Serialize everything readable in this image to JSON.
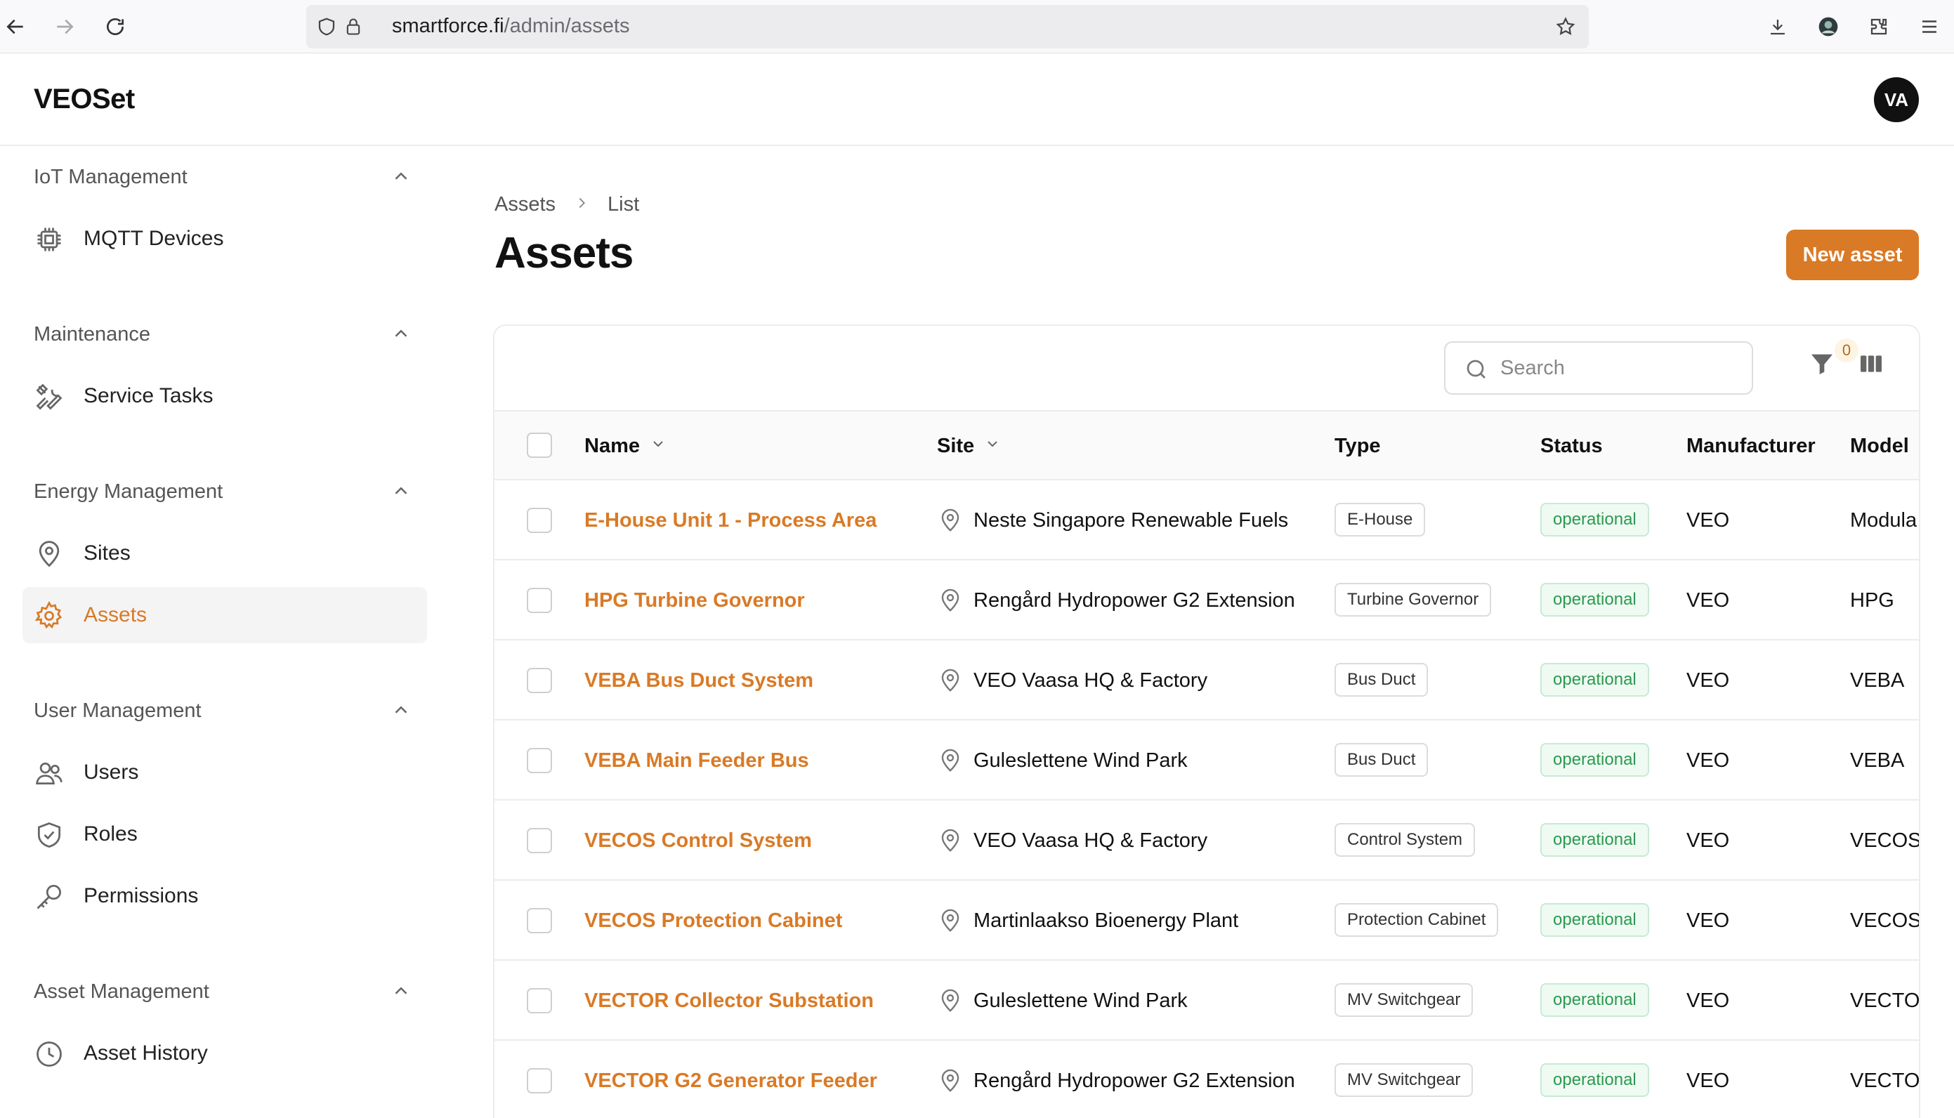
{
  "browser": {
    "url_host": "smartforce.fi",
    "url_path": "/admin/assets"
  },
  "app": {
    "brand": "VEOSet",
    "user_initials": "VA"
  },
  "sidebar": {
    "groups": [
      {
        "title": "IoT Management",
        "items": [
          {
            "label": "MQTT Devices",
            "icon": "chip-icon"
          }
        ]
      },
      {
        "title": "Maintenance",
        "items": [
          {
            "label": "Service Tasks",
            "icon": "tools-icon"
          }
        ]
      },
      {
        "title": "Energy Management",
        "items": [
          {
            "label": "Sites",
            "icon": "map-pin-icon"
          },
          {
            "label": "Assets",
            "icon": "cog-icon",
            "active": true
          }
        ]
      },
      {
        "title": "User Management",
        "items": [
          {
            "label": "Users",
            "icon": "users-icon"
          },
          {
            "label": "Roles",
            "icon": "shield-check-icon"
          },
          {
            "label": "Permissions",
            "icon": "key-icon"
          }
        ]
      },
      {
        "title": "Asset Management",
        "items": [
          {
            "label": "Asset History",
            "icon": "clock-icon"
          }
        ]
      }
    ]
  },
  "page": {
    "breadcrumb": [
      "Assets",
      "List"
    ],
    "title": "Assets",
    "new_button": "New asset"
  },
  "toolbar": {
    "search_placeholder": "Search",
    "filter_count": "0"
  },
  "table": {
    "columns": {
      "name": "Name",
      "site": "Site",
      "type": "Type",
      "status": "Status",
      "manufacturer": "Manufacturer",
      "model": "Model"
    },
    "rows": [
      {
        "name": "E-House Unit 1 - Process Area",
        "site": "Neste Singapore Renewable Fuels",
        "type": "E-House",
        "status": "operational",
        "manufacturer": "VEO",
        "model": "Modula"
      },
      {
        "name": "HPG Turbine Governor",
        "site": "Rengård Hydropower G2 Extension",
        "type": "Turbine Governor",
        "status": "operational",
        "manufacturer": "VEO",
        "model": "HPG"
      },
      {
        "name": "VEBA Bus Duct System",
        "site": "VEO Vaasa HQ & Factory",
        "type": "Bus Duct",
        "status": "operational",
        "manufacturer": "VEO",
        "model": "VEBA"
      },
      {
        "name": "VEBA Main Feeder Bus",
        "site": "Guleslettene Wind Park",
        "type": "Bus Duct",
        "status": "operational",
        "manufacturer": "VEO",
        "model": "VEBA"
      },
      {
        "name": "VECOS Control System",
        "site": "VEO Vaasa HQ & Factory",
        "type": "Control System",
        "status": "operational",
        "manufacturer": "VEO",
        "model": "VECOS"
      },
      {
        "name": "VECOS Protection Cabinet",
        "site": "Martinlaakso Bioenergy Plant",
        "type": "Protection Cabinet",
        "status": "operational",
        "manufacturer": "VEO",
        "model": "VECOS"
      },
      {
        "name": "VECTOR Collector Substation",
        "site": "Guleslettene Wind Park",
        "type": "MV Switchgear",
        "status": "operational",
        "manufacturer": "VEO",
        "model": "VECTOI"
      },
      {
        "name": "VECTOR G2 Generator Feeder",
        "site": "Rengård Hydropower G2 Extension",
        "type": "MV Switchgear",
        "status": "operational",
        "manufacturer": "VEO",
        "model": "VECTOI"
      }
    ]
  },
  "colors": {
    "accent": "#d97a26",
    "status_ok": "#2b9a4f"
  }
}
